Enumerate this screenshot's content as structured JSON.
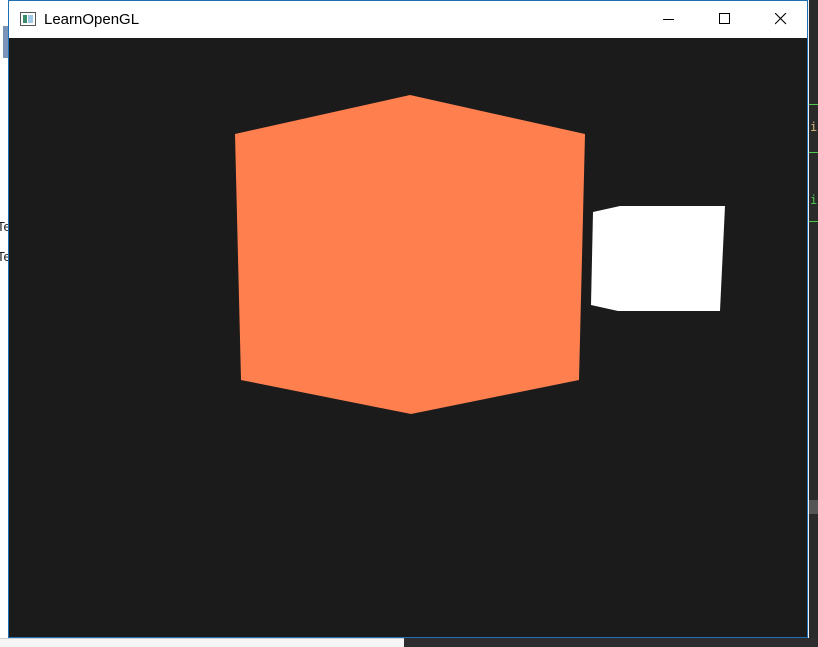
{
  "window": {
    "title": "LearnOpenGL",
    "icon": "app-window-icon",
    "controls": [
      "minimize-icon",
      "maximize-icon",
      "close-icon"
    ]
  },
  "scene": {
    "background_color": "#1b1b1b",
    "object_color": "#ff7f4f",
    "light_color": "#ffffff"
  },
  "background_fragments": {
    "left": [
      "Te",
      "Te"
    ],
    "right": [
      "i",
      "i"
    ]
  }
}
